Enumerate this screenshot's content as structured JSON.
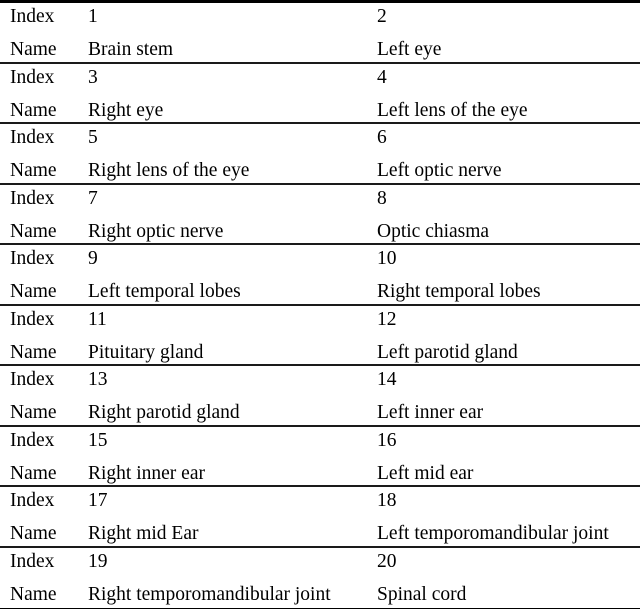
{
  "table": {
    "label_index": "Index",
    "label_name": "Name",
    "colors": {
      "text": "#000000",
      "background": "#ffffff",
      "rule": "#1a1a1a"
    },
    "groups": [
      {
        "left": {
          "index": "1",
          "name": "Brain stem"
        },
        "right": {
          "index": "2",
          "name": "Left eye"
        }
      },
      {
        "left": {
          "index": "3",
          "name": "Right eye"
        },
        "right": {
          "index": "4",
          "name": "Left lens of the eye"
        }
      },
      {
        "left": {
          "index": "5",
          "name": "Right lens of the eye"
        },
        "right": {
          "index": "6",
          "name": "Left optic nerve"
        }
      },
      {
        "left": {
          "index": "7",
          "name": "Right optic nerve"
        },
        "right": {
          "index": "8",
          "name": "Optic chiasma"
        }
      },
      {
        "left": {
          "index": "9",
          "name": "Left temporal lobes"
        },
        "right": {
          "index": "10",
          "name": "Right temporal lobes"
        }
      },
      {
        "left": {
          "index": "11",
          "name": "Pituitary gland"
        },
        "right": {
          "index": "12",
          "name": "Left parotid gland"
        }
      },
      {
        "left": {
          "index": "13",
          "name": "Right parotid gland"
        },
        "right": {
          "index": "14",
          "name": "Left inner ear"
        }
      },
      {
        "left": {
          "index": "15",
          "name": "Right inner ear"
        },
        "right": {
          "index": "16",
          "name": "Left mid ear"
        }
      },
      {
        "left": {
          "index": "17",
          "name": "Right mid Ear"
        },
        "right": {
          "index": "18",
          "name": "Left temporomandibular joint"
        }
      },
      {
        "left": {
          "index": "19",
          "name": "Right temporomandibular joint"
        },
        "right": {
          "index": "20",
          "name": "Spinal cord"
        }
      }
    ]
  }
}
